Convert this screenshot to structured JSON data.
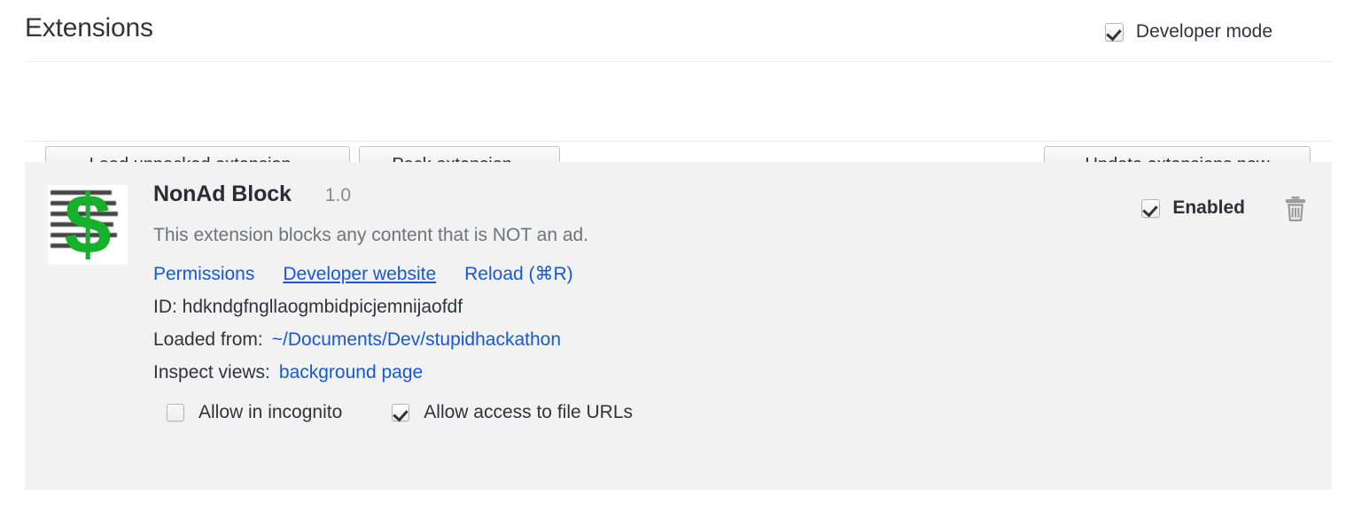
{
  "header": {
    "title": "Extensions",
    "developer_mode": {
      "label": "Developer mode",
      "checked": true,
      "icon": "checkbox-checked-icon"
    }
  },
  "toolbar": {
    "load_unpacked_label": "Load unpacked extension...",
    "pack_label": "Pack extension...",
    "update_label": "Update extensions now"
  },
  "extension": {
    "icon": {
      "name": "dollar-sign-icon",
      "glyph": "$",
      "color": "#16b12b"
    },
    "name": "NonAd Block",
    "version": "1.0",
    "description": "This extension blocks any content that is NOT an ad.",
    "links": [
      {
        "label": "Permissions",
        "underlined": false
      },
      {
        "label": "Developer website",
        "underlined": true
      },
      {
        "label": "Reload (⌘R)",
        "underlined": false
      }
    ],
    "id_label": "ID: ",
    "id_value": "hdkndgfngllaogmbidpicjemnijaofdf",
    "loaded_from_label": "Loaded from:",
    "loaded_from_value": "~/Documents/Dev/stupidhackathon",
    "inspect_views_label": "Inspect views:",
    "inspect_views_value": "background page",
    "allow_incognito": {
      "label": "Allow in incognito",
      "checked": false,
      "icon": "checkbox-unchecked-icon"
    },
    "allow_file_urls": {
      "label": "Allow access to file URLs",
      "checked": true,
      "icon": "checkbox-checked-icon"
    },
    "enabled": {
      "label": "Enabled",
      "checked": true,
      "icon": "checkbox-checked-icon"
    },
    "remove": {
      "icon": "trash-icon"
    }
  },
  "colors": {
    "link": "#1559d6",
    "accent_green": "#16b12b",
    "card_bg": "#f2f2f2",
    "text_primary": "#2f333a",
    "text_muted": "#6f7479"
  }
}
